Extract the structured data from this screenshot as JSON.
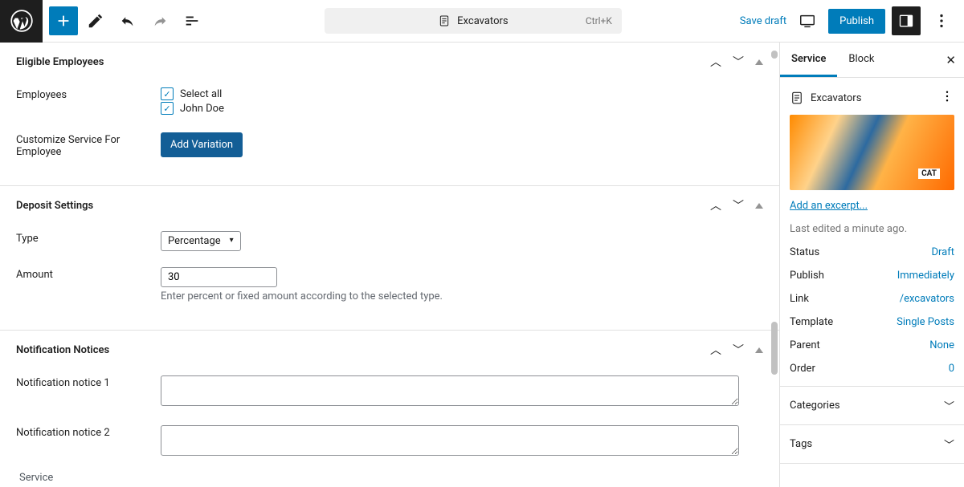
{
  "topbar": {
    "doc_title": "Excavators",
    "shortcut": "Ctrl+K",
    "save_draft": "Save draft",
    "publish": "Publish"
  },
  "editor": {
    "sections": {
      "eligible": {
        "title": "Eligible Employees",
        "employees_label": "Employees",
        "select_all": "Select all",
        "employee_1": "John Doe",
        "customize_label1": "Customize Service For",
        "customize_label2": "Employee",
        "add_variation": "Add Variation"
      },
      "deposit": {
        "title": "Deposit Settings",
        "type_label": "Type",
        "type_value": "Percentage",
        "amount_label": "Amount",
        "amount_value": "30",
        "help": "Enter percent or fixed amount according to the selected type."
      },
      "notifications": {
        "title": "Notification Notices",
        "n1_label": "Notification notice 1",
        "n2_label": "Notification notice 2"
      }
    },
    "bottom_tab": "Service"
  },
  "sidebar": {
    "tabs": {
      "service": "Service",
      "block": "Block"
    },
    "doc_title": "Excavators",
    "excerpt_link": "Add an excerpt...",
    "last_edited": "Last edited a minute ago.",
    "meta": {
      "status_label": "Status",
      "status_value": "Draft",
      "publish_label": "Publish",
      "publish_value": "Immediately",
      "link_label": "Link",
      "link_value": "/excavators",
      "template_label": "Template",
      "template_value": "Single Posts",
      "parent_label": "Parent",
      "parent_value": "None",
      "order_label": "Order",
      "order_value": "0"
    },
    "categories": "Categories",
    "tags": "Tags"
  }
}
